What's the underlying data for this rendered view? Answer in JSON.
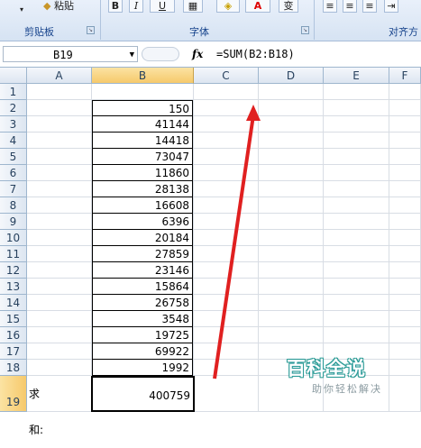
{
  "ribbon": {
    "paste_label": "粘贴",
    "clipboard_group": "剪贴板",
    "font_group": "字体",
    "alignment_group": "对齐方",
    "bold": "B",
    "italic": "I",
    "underline": "U",
    "font_color": "A",
    "phonetic": "变"
  },
  "formula_bar": {
    "name_box": "B19",
    "fx": "fx",
    "formula": "=SUM(B2:B18)"
  },
  "columns": [
    "A",
    "B",
    "C",
    "D",
    "E",
    "F"
  ],
  "rows": [
    "1",
    "2",
    "3",
    "4",
    "5",
    "6",
    "7",
    "8",
    "9",
    "10",
    "11",
    "12",
    "13",
    "14",
    "15",
    "16",
    "17",
    "18",
    "19"
  ],
  "cells": {
    "B": [
      "",
      "150",
      "41144",
      "14418",
      "73047",
      "11860",
      "28138",
      "16608",
      "6396",
      "20184",
      "27859",
      "23146",
      "15864",
      "26758",
      "3548",
      "19725",
      "69922",
      "1992",
      "400759"
    ],
    "A19": "求和:"
  },
  "watermark": {
    "title": "百科全说",
    "subtitle": "助你轻松解决"
  },
  "colors": {
    "arrow": "#e02020",
    "selected_header": "#f6c96b",
    "grid_line": "#d8dde4"
  }
}
